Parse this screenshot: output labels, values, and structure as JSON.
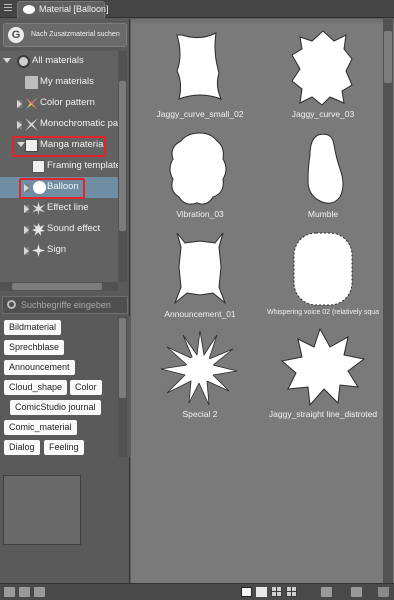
{
  "window": {
    "tab_title": "Material [Balloon]"
  },
  "search_more": {
    "label": "Nach Zusatzmaterial suchen"
  },
  "tree": {
    "items": [
      {
        "label": "All materials",
        "icon": "globe-icon"
      },
      {
        "label": "My materials",
        "icon": "folder-icon"
      },
      {
        "label": "Color pattern",
        "icon": "color-pattern-icon"
      },
      {
        "label": "Monochromatic pat",
        "icon": "monochromatic-pattern-icon"
      },
      {
        "label": "Manga material",
        "icon": "manga-material-icon"
      },
      {
        "label": "Framing template",
        "icon": "framing-template-icon"
      },
      {
        "label": "Balloon",
        "icon": "balloon-icon"
      },
      {
        "label": "Effect line",
        "icon": "effect-line-icon"
      },
      {
        "label": "Sound effect",
        "icon": "sound-effect-icon"
      },
      {
        "label": "Sign",
        "icon": "sign-icon"
      }
    ],
    "selected": "Balloon",
    "highlight_color": "#e3242b",
    "selected_color": "#6f8ea4"
  },
  "tag_search": {
    "placeholder": "Suchbegriffe eingeben",
    "value": ""
  },
  "tags": [
    "Bildmaterial",
    "Sprechblase",
    "Announcement",
    "Cloud_shape",
    "Color",
    "ComicStudio journal",
    "Comic_material",
    "Dialog",
    "Feeling"
  ],
  "materials": [
    {
      "name": "Jaggy_curve_small_02",
      "shape": "jaggy-small"
    },
    {
      "name": "Jaggy_curve_03",
      "shape": "jaggy"
    },
    {
      "name": "Vibration_03",
      "shape": "vibration"
    },
    {
      "name": "Mumble",
      "shape": "mumble"
    },
    {
      "name": "Announcement_01",
      "shape": "announcement"
    },
    {
      "name": "Whispering voice 02 (relatively squa",
      "shape": "whisper"
    },
    {
      "name": "Special 2",
      "shape": "special"
    },
    {
      "name": "Jaggy_straight line_distroted",
      "shape": "jaggy-straight"
    }
  ],
  "bottom_toolbar": {
    "left_icons": [
      "new-folder-icon",
      "folder-icon",
      "folder-open-icon"
    ],
    "right_icons": [
      "checkbox-icon",
      "list-view-icon",
      "small-grid-icon",
      "large-grid-icon",
      "add-material-icon",
      "import-icon",
      "delete-icon"
    ]
  }
}
